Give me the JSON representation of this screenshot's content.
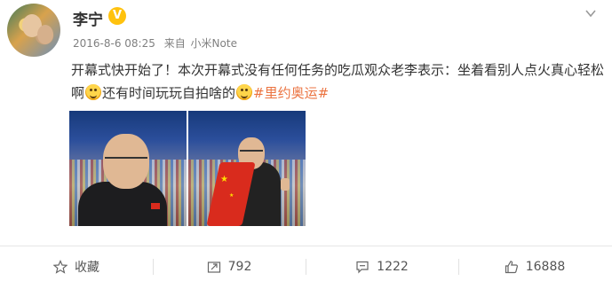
{
  "user": {
    "name": "李宁",
    "verified_badge": "V",
    "timestamp": "2016-8-6 08:25",
    "source_prefix": "来自",
    "source": "小米Note"
  },
  "post": {
    "text_part1": "开幕式快开始了！本次开幕式没有任何任务的吃瓜观众老李表示：坐着看别人点火真心轻松啊",
    "text_part2": "还有时间玩玩自拍啥的",
    "hashtag": "#里约奥运#",
    "emoji1": "laughing-emoji",
    "emoji2": "smile-emoji"
  },
  "actions": {
    "favorite_label": "收藏",
    "repost_count": "792",
    "comment_count": "1222",
    "like_count": "16888"
  },
  "colors": {
    "hashtag": "#eb7340",
    "verified": "#ffc20e",
    "meta_text": "#808080"
  },
  "icons": {
    "verified": "verified-badge-icon",
    "more": "chevron-down-icon",
    "favorite": "star-icon",
    "repost": "repost-icon",
    "comment": "comment-icon",
    "like": "thumbs-up-icon"
  }
}
